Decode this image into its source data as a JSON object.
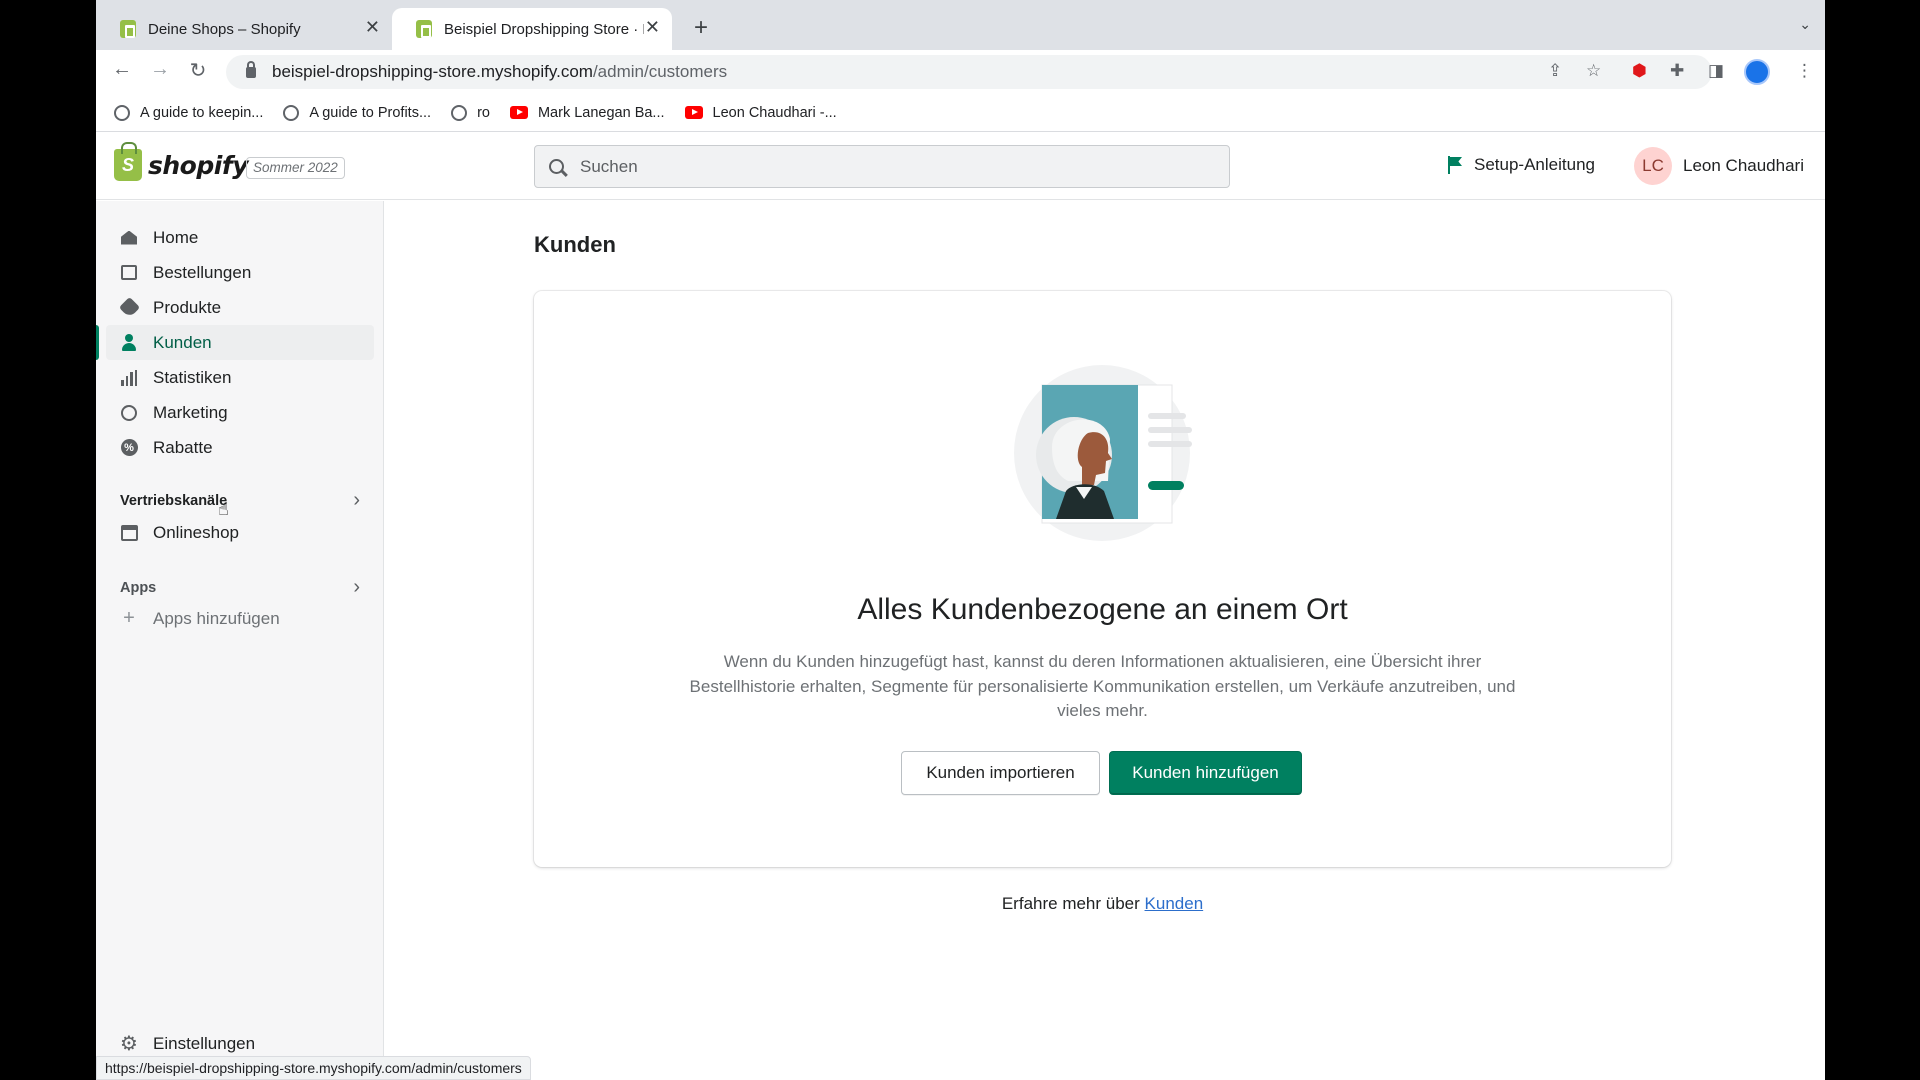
{
  "browser": {
    "tabs": [
      {
        "title": "Deine Shops – Shopify"
      },
      {
        "title": "Beispiel Dropshipping Store · K"
      }
    ],
    "url_host": "beispiel-dropshipping-store.myshopify.com",
    "url_path": "/admin/customers",
    "bookmarks": [
      {
        "label": "A guide to keepin...",
        "icon": "globe-icon"
      },
      {
        "label": "A guide to Profits...",
        "icon": "globe-icon"
      },
      {
        "label": "ro",
        "icon": "globe-icon"
      },
      {
        "label": "Mark Lanegan Ba...",
        "icon": "youtube-icon"
      },
      {
        "label": "Leon Chaudhari -...",
        "icon": "youtube-icon"
      }
    ],
    "status_url": "https://beispiel-dropshipping-store.myshopify.com/admin/customers"
  },
  "topbar": {
    "logo_text": "shopify",
    "edition": "Sommer 2022",
    "search_placeholder": "Suchen",
    "setup_label": "Setup-Anleitung",
    "user_initials": "LC",
    "user_name": "Leon Chaudhari"
  },
  "sidebar": {
    "items": [
      {
        "label": "Home"
      },
      {
        "label": "Bestellungen"
      },
      {
        "label": "Produkte"
      },
      {
        "label": "Kunden",
        "active": true
      },
      {
        "label": "Statistiken"
      },
      {
        "label": "Marketing"
      },
      {
        "label": "Rabatte"
      }
    ],
    "sales_channels_heading": "Vertriebskanäle",
    "online_store": "Onlineshop",
    "apps_heading": "Apps",
    "add_apps": "Apps hinzufügen",
    "settings": "Einstellungen"
  },
  "main": {
    "title": "Kunden",
    "empty_heading": "Alles Kundenbezogene an einem Ort",
    "empty_body": "Wenn du Kunden hinzugefügt hast, kannst du deren Informationen aktualisieren, eine Übersicht ihrer Bestellhistorie erhalten, Segmente für personalisierte Kommunikation erstellen, um Verkäufe anzutreiben, und vieles mehr.",
    "import_button": "Kunden importieren",
    "add_button": "Kunden hinzufügen",
    "learn_more_prefix": "Erfahre mehr über",
    "learn_more_link": "Kunden"
  },
  "colors": {
    "accent": "#008060",
    "link": "#2c6ecb",
    "shopify_green": "#95bf47"
  }
}
